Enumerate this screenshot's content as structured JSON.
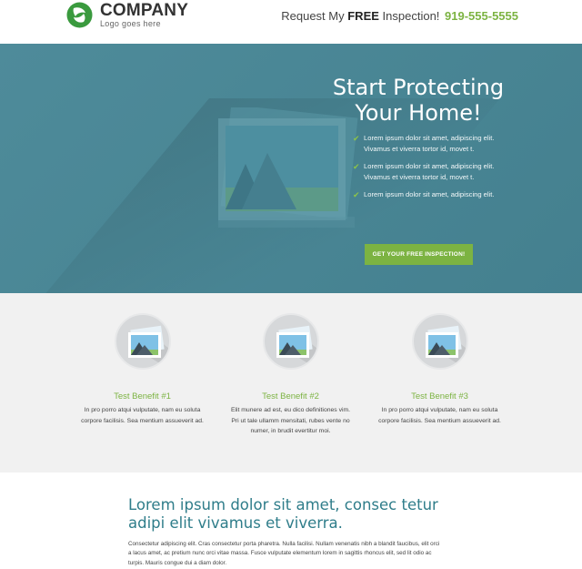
{
  "header": {
    "company_name": "COMPANY",
    "tagline": "Logo goes here",
    "cta_prefix": "Request My",
    "cta_free": "FREE",
    "cta_suffix": "Inspection!",
    "phone": "919-555-5555",
    "logo_icon": "leaf-logo-icon"
  },
  "hero": {
    "title_line1": "Start Protecting",
    "title_line2": "Your Home!",
    "bullets": [
      "Lorem ipsum dolor sit amet, adipiscing elit. Vivamus et viverra tortor id, movet t.",
      "Lorem ipsum dolor sit amet, adipiscing elit. Vivamus et viverra tortor id, movet t.",
      "Lorem ipsum dolor sit amet, adipiscing elit."
    ],
    "button_label": "GET YOUR FREE INSPECTION!",
    "bullet_icon": "check-icon",
    "image_icon": "image-placeholder-icon"
  },
  "benefits": [
    {
      "title": "Test Benefit #1",
      "text": "In pro porro atqui vulputate, nam eu soluta corpore facilisis. Sea mentium assueverit ad."
    },
    {
      "title": "Test Benefit #2",
      "text": "Elit munere ad est, eu dico definitiones vim. Pri ut tale ullamm mensitati, rubes vente no numer, in brudit evertitur moi."
    },
    {
      "title": "Test Benefit #3",
      "text": "In pro porro atqui vulputate, nam eu soluta corpore facilisis. Sea mentium assueverit ad."
    }
  ],
  "lower": {
    "heading": "Lorem ipsum dolor sit amet, consec tetur adipi elit vivamus et viverra.",
    "body": "Consectetur adipiscing elit. Cras consectetur porta pharetra. Nulla facilisi. Nullam venenatis nibh a blandit faucibus, elit orci a lacus amet, ac pretium nunc orci vitae massa. Fusce vulputate elementum lorem in sagittis rhoncus elit, sed lit odio ac turpis. Mauris congue dui a diam dolor."
  },
  "colors": {
    "accent_green": "#7cb342",
    "hero_teal": "#4e8b9a",
    "heading_teal": "#2f7d8a"
  }
}
